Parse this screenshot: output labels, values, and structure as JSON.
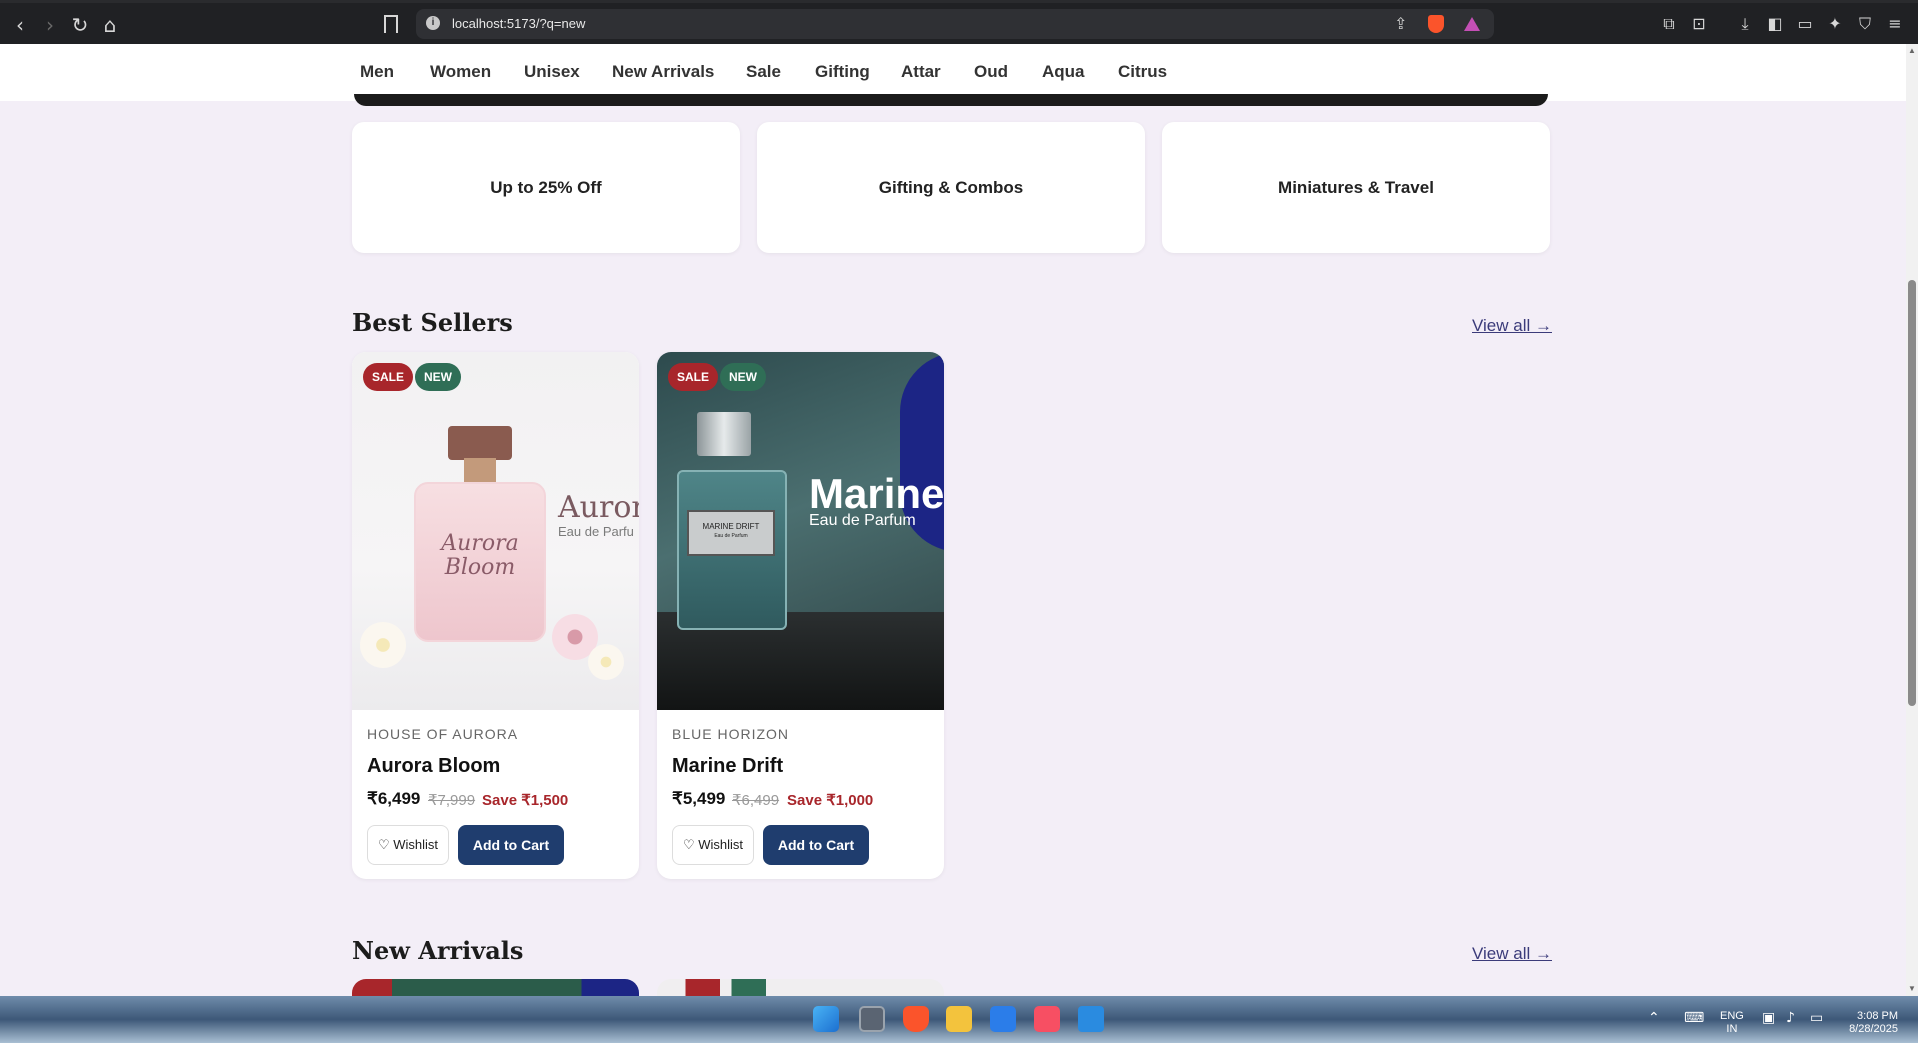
{
  "browser": {
    "url": "localhost:5173/?q=new",
    "back_icon": "‹",
    "forward_icon": "›",
    "reload_icon": "↻",
    "home_icon": "⌂",
    "info_icon": "i",
    "share_icon": "⇪",
    "tools": [
      "⧉",
      "⊡",
      "⤓",
      "◧",
      "▭",
      "✦",
      "⛉",
      "≡"
    ]
  },
  "nav": {
    "categories": [
      "Men",
      "Women",
      "Unisex",
      "New Arrivals",
      "Sale",
      "Gifting",
      "Attar",
      "Oud",
      "Aqua",
      "Citrus"
    ]
  },
  "promos": [
    "Up to 25% Off",
    "Gifting & Combos",
    "Miniatures & Travel"
  ],
  "best_sellers": {
    "title": "Best Sellers",
    "view_all": "View all →",
    "products": [
      {
        "badges": [
          "SALE",
          "NEW"
        ],
        "brand": "HOUSE OF AURORA",
        "name": "Aurora Bloom",
        "price": "₹6,499",
        "mrp": "₹7,999",
        "save": "Save ₹1,500",
        "wishlist": "♡ Wishlist",
        "add_to_cart": "Add to Cart",
        "image_title": "Aurora",
        "image_sub": "Eau de Parfu",
        "bottle_text": "Aurora Bloom"
      },
      {
        "badges": [
          "SALE",
          "NEW"
        ],
        "brand": "BLUE HORIZON",
        "name": "Marine Drift",
        "price": "₹5,499",
        "mrp": "₹6,499",
        "save": "Save ₹1,000",
        "wishlist": "♡ Wishlist",
        "add_to_cart": "Add to Cart",
        "image_title": "Marine",
        "image_sub": "Eau de Parfum",
        "label_title": "MARINE DRIFT",
        "label_sub": "Eau de Parfum"
      }
    ]
  },
  "new_arrivals": {
    "title": "New Arrivals",
    "view_all": "View all →"
  },
  "taskbar": {
    "lang_top": "ENG",
    "lang_bottom": "IN",
    "time": "3:08 PM",
    "date": "8/28/2025"
  },
  "colors": {
    "accent_navy": "#1f3d6e",
    "sale_red": "#a8262b",
    "new_green": "#2f6e56"
  }
}
